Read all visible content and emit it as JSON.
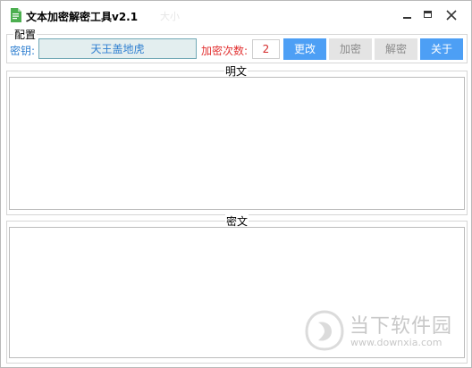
{
  "window": {
    "title": "文本加密解密工具v2.1",
    "ghost_text": "大小"
  },
  "config": {
    "group_label": "配置",
    "key_label": "密钥:",
    "key_value": "天王盖地虎",
    "count_label": "加密次数:",
    "count_value": "2",
    "buttons": {
      "change": "更改",
      "encrypt": "加密",
      "decrypt": "解密",
      "about": "关于"
    }
  },
  "plaintext": {
    "group_label": "明文",
    "value": ""
  },
  "ciphertext": {
    "group_label": "密文",
    "value": ""
  },
  "watermark": {
    "title": "当下软件园",
    "url": "www.downxia.com"
  },
  "colors": {
    "accent_button": "#4d9ff5",
    "disabled_button": "#e4e4e4",
    "key_label": "#2f7fd0",
    "count_label": "#e23232"
  }
}
